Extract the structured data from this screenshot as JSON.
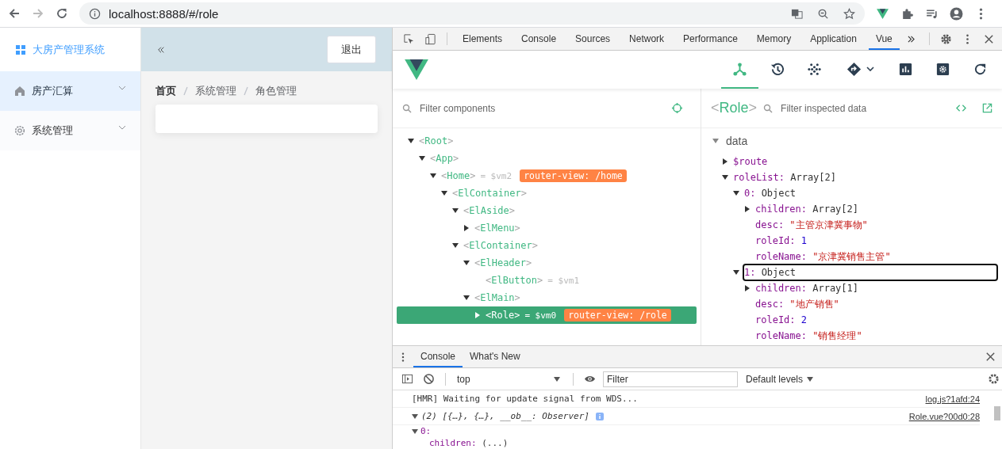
{
  "browser": {
    "url": "localhost:8888/#/role"
  },
  "app": {
    "logo": "大房产管理系统",
    "menu": [
      {
        "label": "房产汇算",
        "kind": "home",
        "selected": true,
        "expanded": false
      },
      {
        "label": "系统管理",
        "kind": "settings",
        "selected": false,
        "expanded": false
      }
    ],
    "logout": "退出",
    "breadcrumb": [
      "首页",
      "系统管理",
      "角色管理"
    ]
  },
  "devtools": {
    "tabs": [
      {
        "label": "Elements",
        "selected": false
      },
      {
        "label": "Console",
        "selected": false
      },
      {
        "label": "Sources",
        "selected": false
      },
      {
        "label": "Network",
        "selected": false
      },
      {
        "label": "Performance",
        "selected": false
      },
      {
        "label": "Memory",
        "selected": false
      },
      {
        "label": "Application",
        "selected": false
      },
      {
        "label": "Vue",
        "selected": true
      }
    ],
    "vue_tools": [
      {
        "kind": "components",
        "selected": true
      },
      {
        "kind": "history",
        "selected": false
      },
      {
        "kind": "vuex",
        "selected": false
      },
      {
        "kind": "routing",
        "selected": false
      },
      {
        "kind": "performance",
        "selected": false
      },
      {
        "kind": "settings",
        "selected": false
      },
      {
        "kind": "refresh",
        "selected": false
      }
    ],
    "components": {
      "placeholder": "Filter components",
      "tree": [
        {
          "name": "<Root>",
          "expanded": true,
          "selected": false,
          "children": [
            {
              "name": "<App>",
              "expanded": true,
              "selected": false,
              "children": [
                {
                  "name": "<Home>",
                  "ref": "= $vm2",
                  "badge": "router-view: /home",
                  "expanded": true,
                  "selected": false,
                  "children": [
                    {
                      "name": "<ElContainer>",
                      "expanded": true,
                      "selected": false,
                      "children": [
                        {
                          "name": "<ElAside>",
                          "expanded": true,
                          "selected": false,
                          "children": [
                            {
                              "name": "<ElMenu>",
                              "expanded": false,
                              "selected": false
                            }
                          ]
                        },
                        {
                          "name": "<ElContainer>",
                          "expanded": true,
                          "selected": false,
                          "children": [
                            {
                              "name": "<ElHeader>",
                              "expanded": true,
                              "selected": false,
                              "children": [
                                {
                                  "name": "<ElButton>",
                                  "ref": "= $vm1",
                                  "selected": false
                                }
                              ]
                            },
                            {
                              "name": "<ElMain>",
                              "expanded": true,
                              "selected": false,
                              "children": [
                                {
                                  "name": "<Role>",
                                  "ref": "= $vm0",
                                  "badge": "router-view: /role",
                                  "expanded": false,
                                  "selected": true
                                }
                              ]
                            }
                          ]
                        }
                      ]
                    }
                  ]
                }
              ]
            }
          ]
        }
      ]
    },
    "inspector": {
      "component": "<Role>",
      "placeholder": "Filter inspected data",
      "section": "data",
      "expanded": true,
      "fields": [
        {
          "key": "$route",
          "expanded": false,
          "selected": false
        },
        {
          "key": "roleList:",
          "value": "Array[2]",
          "kind": "object",
          "expanded": true,
          "selected": false,
          "children": [
            {
              "key": "0:",
              "value": "Object",
              "kind": "object",
              "expanded": true,
              "selected": false,
              "children": [
                {
                  "key": "children:",
                  "value": "Array[2]",
                  "kind": "object",
                  "expanded": false,
                  "selected": false
                },
                {
                  "key": "desc:",
                  "value": "\"主管京津冀事物\"",
                  "kind": "string",
                  "selected": false
                },
                {
                  "key": "roleId:",
                  "value": "1",
                  "kind": "number",
                  "selected": false
                },
                {
                  "key": "roleName:",
                  "value": "\"京津冀销售主管\"",
                  "kind": "string",
                  "selected": false
                }
              ]
            },
            {
              "key": "1:",
              "value": "Object",
              "kind": "object",
              "expanded": true,
              "selected": true,
              "children": [
                {
                  "key": "children:",
                  "value": "Array[1]",
                  "kind": "object",
                  "expanded": false,
                  "selected": false
                },
                {
                  "key": "desc:",
                  "value": "\"地产销售\"",
                  "kind": "string",
                  "selected": false
                },
                {
                  "key": "roleId:",
                  "value": "2",
                  "kind": "number",
                  "selected": false
                },
                {
                  "key": "roleName:",
                  "value": "\"销售经理\"",
                  "kind": "string",
                  "selected": false
                }
              ]
            }
          ]
        }
      ]
    },
    "console": {
      "tabs": [
        {
          "label": "Console",
          "selected": true
        },
        {
          "label": "What's New",
          "selected": false
        }
      ],
      "context": "top",
      "filter_placeholder": "Filter",
      "levels": "Default levels",
      "messages": [
        {
          "text": "[HMR] Waiting for update signal from WDS...",
          "source": "log.js?1afd:24"
        },
        {
          "text": "(2) [{…}, {…}, __ob__: Observer]",
          "source": "Role.vue?00d0:28",
          "expanded": true,
          "children": [
            {
              "key": "0:",
              "expanded": true,
              "children": [
                {
                  "key": "children:",
                  "value": "(...)"
                }
              ]
            }
          ]
        }
      ]
    }
  }
}
